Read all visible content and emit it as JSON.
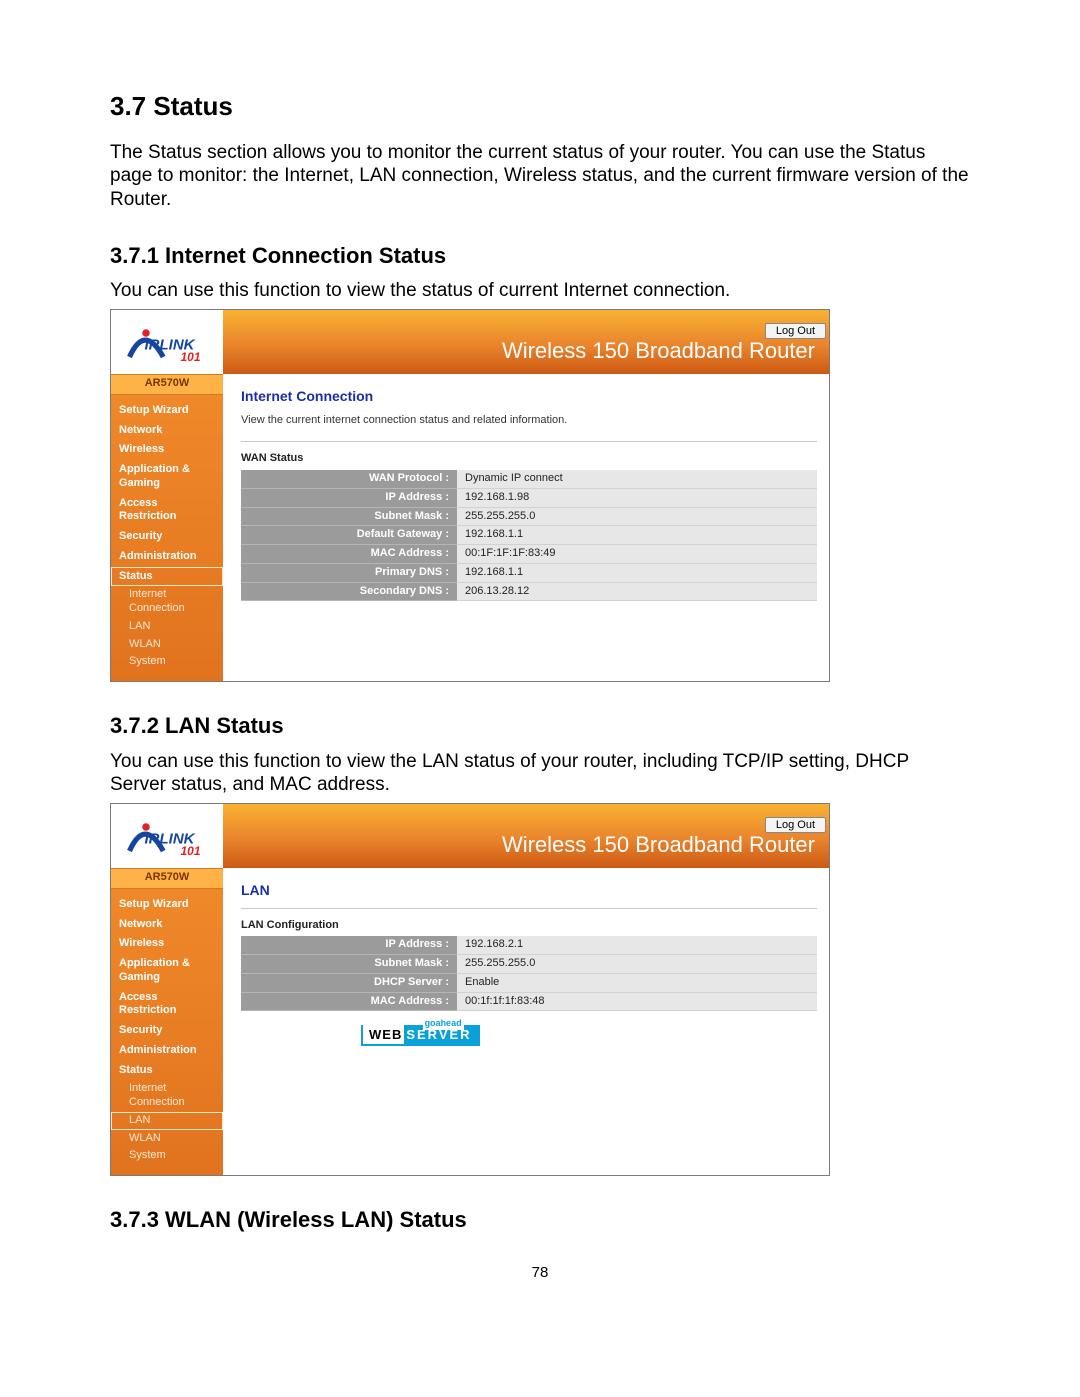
{
  "doc": {
    "h_status": "3.7 Status",
    "p_status": "The Status section allows you to monitor the current status of your router. You can use the Status page to monitor: the Internet, LAN connection, Wireless status, and the current firmware version of the Router.",
    "h_371": "3.7.1 Internet Connection Status",
    "p_371": "You can use this function to view the status of current Internet connection.",
    "h_372": "3.7.2 LAN Status",
    "p_372": "You can use this function to view the LAN status of your router, including TCP/IP setting, DHCP Server status, and MAC address.",
    "h_373": "3.7.3 WLAN (Wireless LAN) Status",
    "page_num": "78"
  },
  "common": {
    "product_line": "Wireless 150 Broadband Router",
    "model": "AR570W",
    "logout": "Log Out",
    "nav": {
      "setup_wizard": "Setup Wizard",
      "network": "Network",
      "wireless": "Wireless",
      "app_gaming": "Application & Gaming",
      "access_restriction": "Access Restriction",
      "security": "Security",
      "administration": "Administration",
      "status": "Status",
      "sub_internet": "Internet Connection",
      "sub_lan": "LAN",
      "sub_wlan": "WLAN",
      "sub_system": "System"
    }
  },
  "shot1": {
    "panel_title": "Internet Connection",
    "panel_desc": "View the current internet connection status and related information.",
    "table_title": "WAN Status",
    "rows": {
      "wan_protocol_k": "WAN Protocol :",
      "wan_protocol_v": "Dynamic IP connect",
      "ip_k": "IP Address :",
      "ip_v": "192.168.1.98",
      "mask_k": "Subnet Mask :",
      "mask_v": "255.255.255.0",
      "gw_k": "Default Gateway :",
      "gw_v": "192.168.1.1",
      "mac_k": "MAC Address :",
      "mac_v": "00:1F:1F:1F:83:49",
      "dns1_k": "Primary DNS :",
      "dns1_v": "192.168.1.1",
      "dns2_k": "Secondary DNS :",
      "dns2_v": "206.13.28.12"
    }
  },
  "shot2": {
    "panel_title": "LAN",
    "table_title": "LAN Configuration",
    "rows": {
      "ip_k": "IP Address :",
      "ip_v": "192.168.2.1",
      "mask_k": "Subnet Mask :",
      "mask_v": "255.255.255.0",
      "dhcp_k": "DHCP Server :",
      "dhcp_v": "Enable",
      "mac_k": "MAC Address :",
      "mac_v": "00:1f:1f:1f:83:48"
    },
    "badge_a": "WEB",
    "badge_b": "SERVER"
  }
}
